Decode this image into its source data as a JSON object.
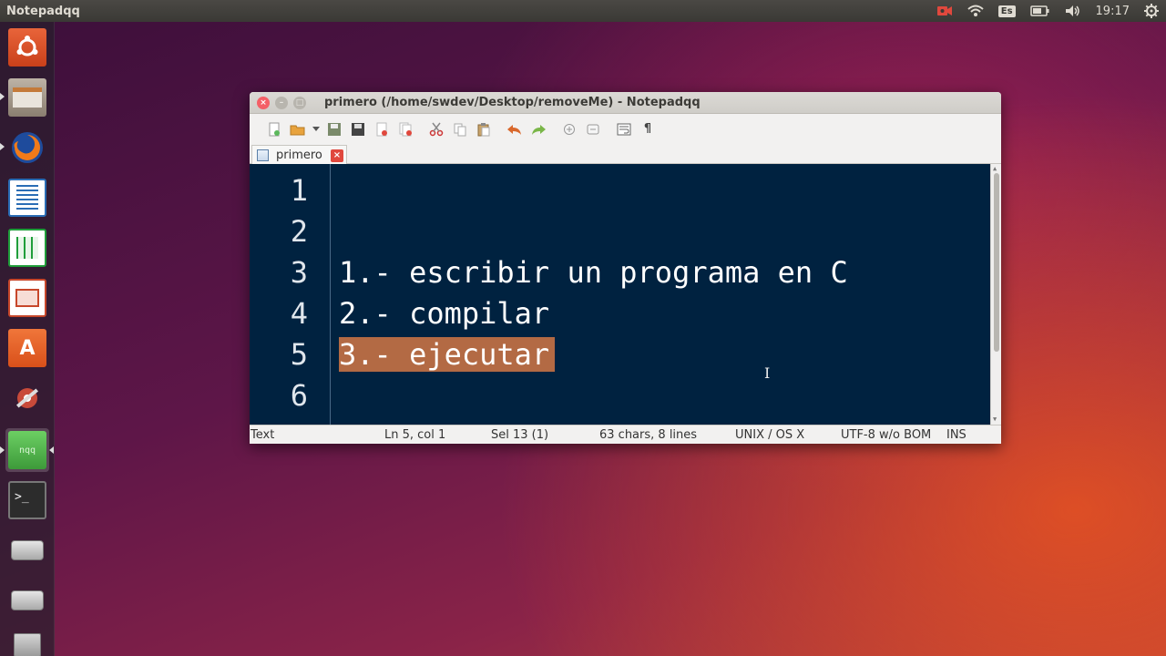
{
  "top_panel": {
    "app_name": "Notepadqq",
    "keyboard_layout": "Es",
    "clock": "19:17",
    "icons": [
      "camera-icon",
      "wifi-icon",
      "keyboard-layout-indicator",
      "battery-icon",
      "volume-icon",
      "gear-icon"
    ]
  },
  "launcher": {
    "items": [
      {
        "name": "ubuntu-dash-icon",
        "color": "#dd4814"
      },
      {
        "name": "files-icon",
        "color": "#8a7a6a"
      },
      {
        "name": "firefox-icon",
        "color": "#e66000"
      },
      {
        "name": "writer-icon",
        "color": "#2a6db5"
      },
      {
        "name": "calc-icon",
        "color": "#1f9e3a"
      },
      {
        "name": "impress-icon",
        "color": "#c7472b"
      },
      {
        "name": "software-center-icon",
        "color": "#e45e1e"
      },
      {
        "name": "system-settings-icon",
        "color": "#b73a3a"
      },
      {
        "name": "notepadqq-icon",
        "color": "#4caf50",
        "label": "nqq"
      },
      {
        "name": "terminal-icon",
        "color": "#2c2c2c"
      },
      {
        "name": "drive-icon",
        "color": "#9a9a9a"
      },
      {
        "name": "drive-icon-2",
        "color": "#9a9a9a"
      },
      {
        "name": "trash-icon",
        "color": "#9a9a9a"
      }
    ]
  },
  "window": {
    "title": "primero (/home/swdev/Desktop/removeMe) - Notepadqq",
    "tab_label": "primero",
    "close_glyph": "×",
    "editor": {
      "line_numbers": [
        "1",
        "2",
        "3",
        "4",
        "5",
        "6"
      ],
      "lines": [
        "",
        "",
        "1.- escribir un programa en C",
        "2.- compilar",
        "3.- ejecutar",
        ""
      ],
      "selected_line_index": 4
    },
    "status": {
      "language": "Text",
      "position": "Ln 5, col 1",
      "selection": "Sel 13 (1)",
      "stats": "63 chars, 8 lines",
      "eol": "UNIX / OS X",
      "encoding": "UTF-8 w/o BOM",
      "mode": "INS"
    }
  },
  "colors": {
    "editor_bg": "#002240",
    "selection": "#b36a44",
    "panel": "#3a3935"
  }
}
